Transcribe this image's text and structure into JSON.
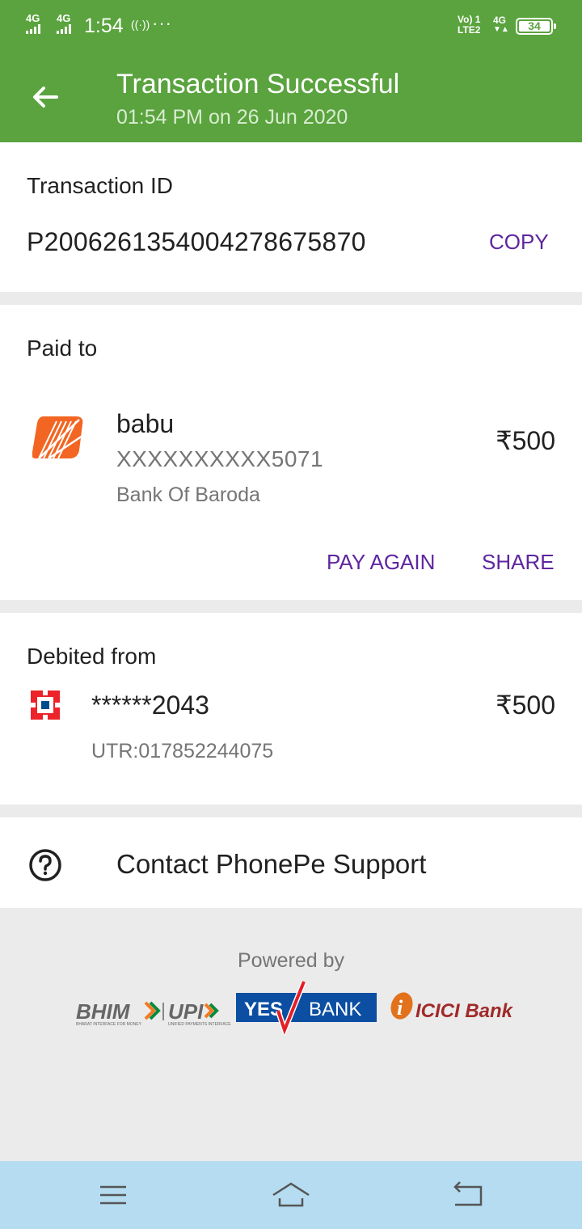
{
  "status_bar": {
    "sim1": "4G",
    "sim2": "4G",
    "time": "1:54",
    "volte_top": "Vo) 1",
    "volte_bottom": "LTE2",
    "network": "4G",
    "battery": "34"
  },
  "header": {
    "title": "Transaction Successful",
    "subtitle": "01:54 PM on 26 Jun 2020"
  },
  "transaction": {
    "label": "Transaction ID",
    "id": "P2006261354004278675870",
    "copy_label": "COPY"
  },
  "paid_to": {
    "label": "Paid to",
    "name": "babu",
    "account": "XXXXXXXXXX5071",
    "bank": "Bank Of Baroda",
    "amount": "₹500",
    "pay_again_label": "PAY AGAIN",
    "share_label": "SHARE"
  },
  "debited_from": {
    "label": "Debited from",
    "account": "******2043",
    "amount": "₹500",
    "utr": "UTR:017852244075"
  },
  "support": {
    "label": "Contact PhonePe Support"
  },
  "footer": {
    "powered_by": "Powered by",
    "logos": {
      "bhim": "BHIM",
      "upi": "UPI",
      "bhim_tagline": "BHARAT INTERFACE FOR MONEY",
      "upi_tagline": "UNIFIED PAYMENTS INTERFACE",
      "yes": "YES",
      "bank": "BANK",
      "icici": "ICICI Bank"
    }
  },
  "colors": {
    "header_green": "#5aa33e",
    "accent_purple": "#5f259f",
    "nav_blue": "#b5dcf1"
  },
  "icons": {
    "back": "arrow-left-icon",
    "help": "question-circle-icon",
    "menu": "hamburger-icon",
    "home": "home-icon",
    "return": "back-icon"
  }
}
